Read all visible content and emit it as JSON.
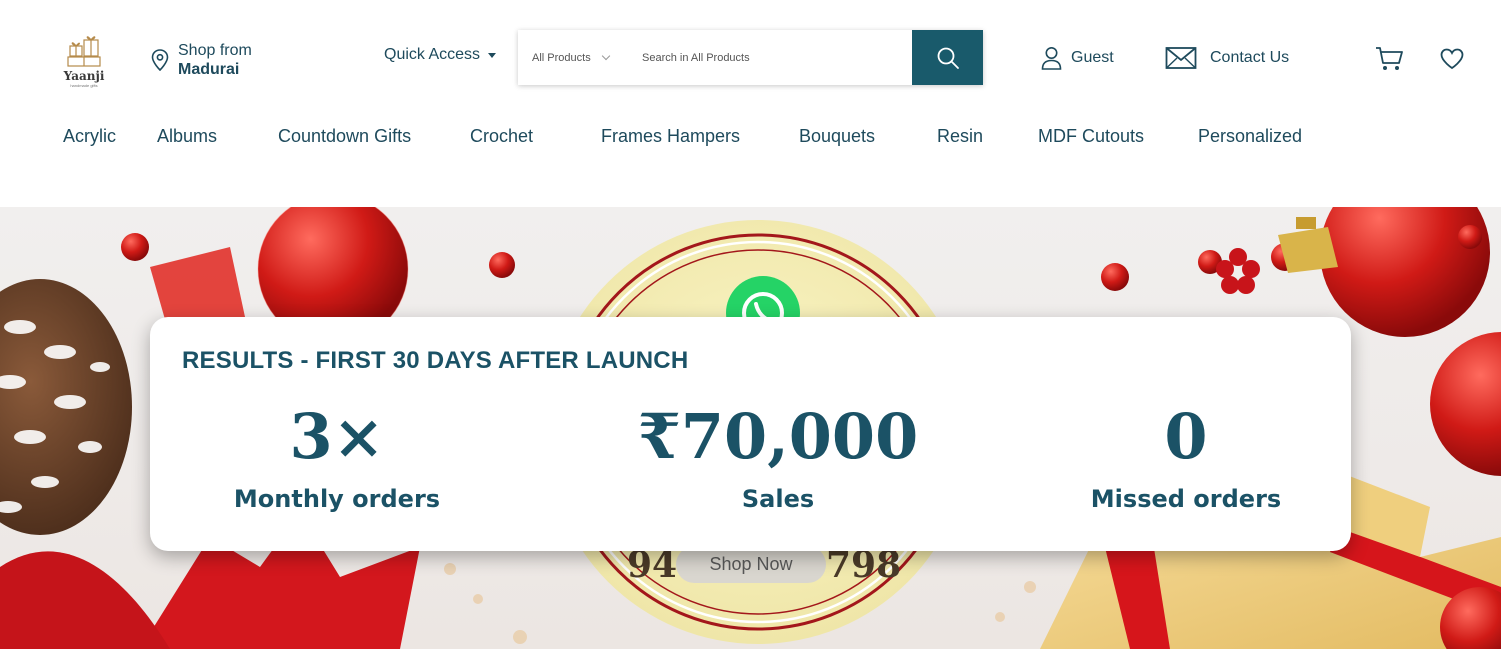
{
  "brand": {
    "logo_text": "Yaanji",
    "tagline": "handmade gifts"
  },
  "location": {
    "prefix": "Shop from",
    "city": "Madurai"
  },
  "quick_access": {
    "label": "Quick Access"
  },
  "search": {
    "category": "All Products",
    "placeholder": "Search in All Products"
  },
  "account": {
    "label": "Guest"
  },
  "contact": {
    "label": "Contact Us"
  },
  "icons": {
    "location": "map-pin-icon",
    "search": "search-icon",
    "user": "user-icon",
    "mail": "mail-icon",
    "cart": "cart-icon",
    "wishlist": "heart-icon",
    "whatsapp": "whatsapp-icon"
  },
  "colors": {
    "brand": "#1e4a5c",
    "accent": "#195a6b",
    "stat_text": "#1b5266",
    "whatsapp": "#25d366"
  },
  "nav": {
    "items": [
      {
        "label": "Acrylic"
      },
      {
        "label": "Albums"
      },
      {
        "label": "Countdown Gifts"
      },
      {
        "label": "Crochet"
      },
      {
        "label": "Frames Hampers"
      },
      {
        "label": "Bouquets"
      },
      {
        "label": "Resin"
      },
      {
        "label": "MDF Cutouts"
      },
      {
        "label": "Personalized"
      }
    ]
  },
  "hero": {
    "cta": "Shop Now",
    "phone_left": "94",
    "phone_right": "798"
  },
  "results": {
    "title": "RESULTS - FIRST 30 DAYS AFTER LAUNCH",
    "stats": [
      {
        "value": "3×",
        "label": "Monthly orders"
      },
      {
        "value": "₹70,000",
        "label": "Sales"
      },
      {
        "value": "0",
        "label": "Missed orders"
      }
    ]
  }
}
